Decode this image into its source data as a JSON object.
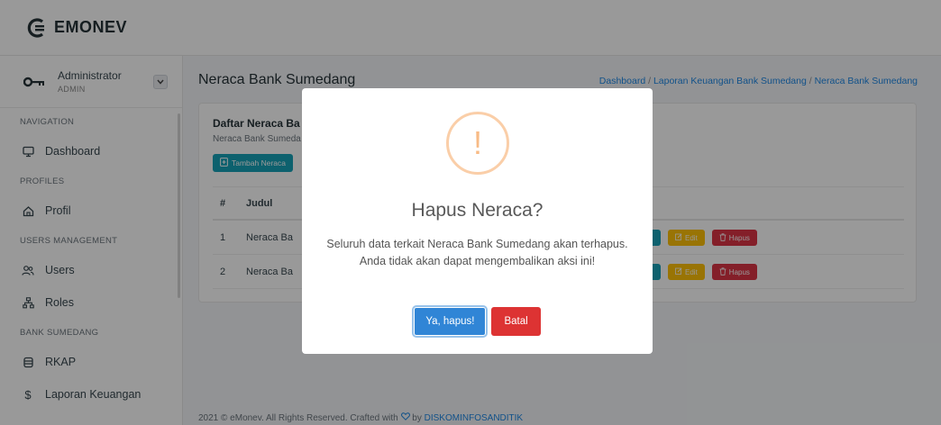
{
  "app": {
    "name": "EMONEV"
  },
  "user": {
    "name": "Administrator",
    "role": "ADMIN",
    "toggle_icon": "chevron-down-icon"
  },
  "sidebar": {
    "sections": [
      {
        "label": "NAVIGATION",
        "items": [
          {
            "label": "Dashboard",
            "icon": "monitor-icon"
          }
        ]
      },
      {
        "label": "PROFILES",
        "items": [
          {
            "label": "Profil",
            "icon": "home-icon"
          }
        ]
      },
      {
        "label": "USERS MANAGEMENT",
        "items": [
          {
            "label": "Users",
            "icon": "users-icon"
          },
          {
            "label": "Roles",
            "icon": "roles-icon"
          }
        ]
      },
      {
        "label": "BANK SUMEDANG",
        "items": [
          {
            "label": "RKAP",
            "icon": "database-icon"
          },
          {
            "label": "Laporan Keuangan",
            "icon": "dollar-icon"
          }
        ]
      }
    ]
  },
  "page": {
    "title": "Neraca Bank Sumedang",
    "breadcrumb": [
      "Dashboard",
      "Laporan Keuangan Bank Sumedang",
      "Neraca Bank Sumedang"
    ],
    "breadcrumb_sep": " / "
  },
  "card": {
    "title": "Daftar Neraca Ba",
    "subtitle": "Neraca Bank Sumeda",
    "add_button": "Tambah Neraca"
  },
  "table": {
    "headers": [
      "#",
      "Judul"
    ],
    "rows": [
      {
        "num": "1",
        "judul": "Neraca Ba",
        "edit": "Edit",
        "delete": "Hapus"
      },
      {
        "num": "2",
        "judul": "Neraca Ba",
        "edit": "Edit",
        "delete": "Hapus"
      }
    ]
  },
  "footer": {
    "text": "2021 © eMonev. All Rights Reserved. Crafted with",
    "by": "by",
    "link": "DISKOMINFOSANDITIK"
  },
  "modal": {
    "icon_glyph": "!",
    "title": "Hapus Neraca?",
    "text": "Seluruh data terkait Neraca Bank Sumedang akan terhapus. Anda tidak akan dapat mengembalikan aksi ini!",
    "confirm": "Ya, hapus!",
    "cancel": "Batal"
  },
  "colors": {
    "accent": "#3085d6",
    "danger": "#dd3333",
    "info": "#17a2b8",
    "warning": "#ffc107",
    "link": "#1e88e5"
  }
}
